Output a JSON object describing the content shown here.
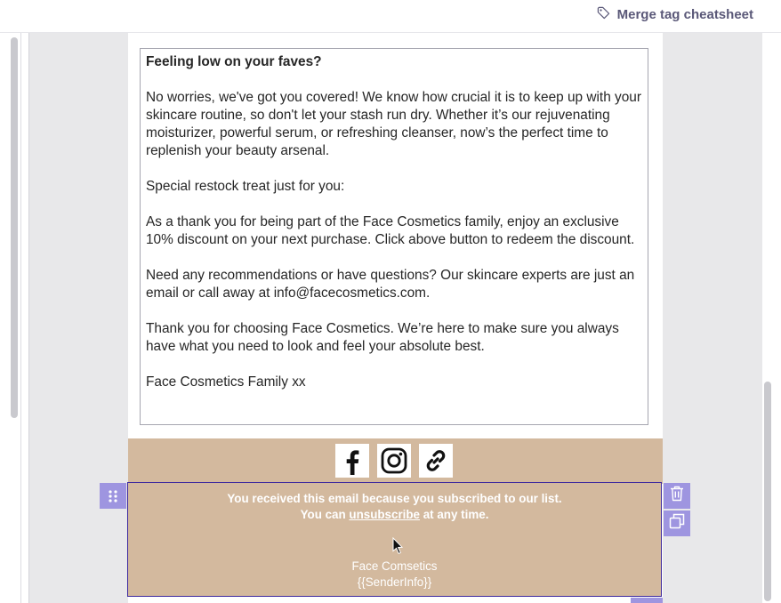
{
  "topbar": {
    "cheatsheet_label": "Merge tag cheatsheet",
    "cheatsheet_icon": "tag-icon"
  },
  "email": {
    "paragraphs": [
      "Feeling low on your faves?",
      "No worries, we've got you covered! We know how crucial it is to keep up with your skincare routine, so don't let your stash run dry. Whether it’s our rejuvenating moisturizer, powerful serum, or refreshing cleanser, now’s the perfect time to replenish your beauty arsenal.",
      "Special restock treat just for you:",
      "As a thank you for being part of the Face Cosmetics family, enjoy an exclusive 10% discount on your next purchase. Click above button to redeem the discount.",
      "Need any recommendations or have questions? Our skincare experts are just an email or call away at info@facecosmetics.com.",
      "Thank you for choosing Face Cosmetics. We’re here to make sure you always have what you need to look and feel your absolute best.",
      "Face Cosmetics Family xx"
    ],
    "social_icons": [
      "facebook-icon",
      "instagram-icon",
      "link-icon"
    ],
    "footer": {
      "line1": "You received this email because you subscribed to our list.",
      "line2_prefix": "You can ",
      "unsubscribe": "unsubscribe",
      "line2_suffix": " at any time.",
      "company": "Face Comsetics",
      "sender_tag": "{{SenderInfo}}"
    },
    "colors": {
      "footer_bg": "#d3b99e",
      "accent": "#9e95e0",
      "selection_border": "#3e2a9e",
      "cheatsheet_text": "#5a5878"
    }
  },
  "tools": {
    "drag_icon": "drag-handle-icon",
    "delete_icon": "trash-icon",
    "duplicate_icon": "duplicate-icon"
  }
}
